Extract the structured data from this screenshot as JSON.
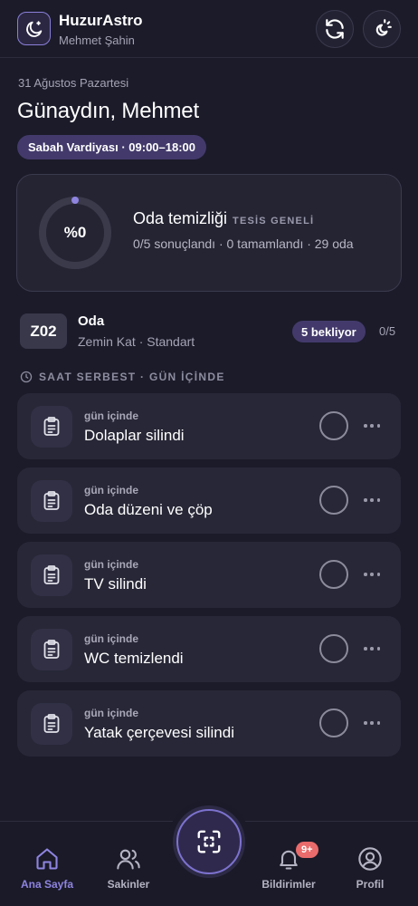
{
  "header": {
    "app_title": "HuzurAstro",
    "user_name": "Mehmet Şahin"
  },
  "dashboard": {
    "date": "31 Ağustos Pazartesi",
    "greeting": "Günaydın, Mehmet",
    "shift": "Sabah Vardiyası · 09:00–18:00"
  },
  "summary": {
    "percent_label": "%0",
    "progress": 0,
    "title": "Oda temizliği",
    "scope": "TESİS GENELİ",
    "stats": "0/5 sonuçlandı · 0 tamamlandı · 29 oda"
  },
  "room": {
    "code": "Z02",
    "name": "Oda",
    "details": "Zemin Kat · Standart",
    "pending": "5 bekliyor",
    "progress": "0/5"
  },
  "section": {
    "label": "SAAT SERBEST · GÜN İÇİNDE"
  },
  "tasks": [
    {
      "when": "gün içinde",
      "title": "Dolaplar silindi"
    },
    {
      "when": "gün içinde",
      "title": "Oda düzeni ve çöp"
    },
    {
      "when": "gün içinde",
      "title": "TV silindi"
    },
    {
      "when": "gün içinde",
      "title": "WC temizlendi"
    },
    {
      "when": "gün içinde",
      "title": "Yatak çerçevesi silindi"
    }
  ],
  "nav": {
    "home": "Ana Sayfa",
    "residents": "Sakinler",
    "notifications": "Bildirimler",
    "notifications_badge": "9+",
    "profile": "Profil",
    "active": "home"
  },
  "colors": {
    "background": "#1b1b2a",
    "accent": "#8f84e0",
    "badge": "#433a6b",
    "notification": "#e96b6b"
  },
  "icons": [
    "moon-logo-icon",
    "refresh-icon",
    "moon-sun-icon",
    "clock-icon",
    "clipboard-icon",
    "more-icon",
    "home-icon",
    "users-icon",
    "scan-icon",
    "bell-icon",
    "user-icon"
  ]
}
